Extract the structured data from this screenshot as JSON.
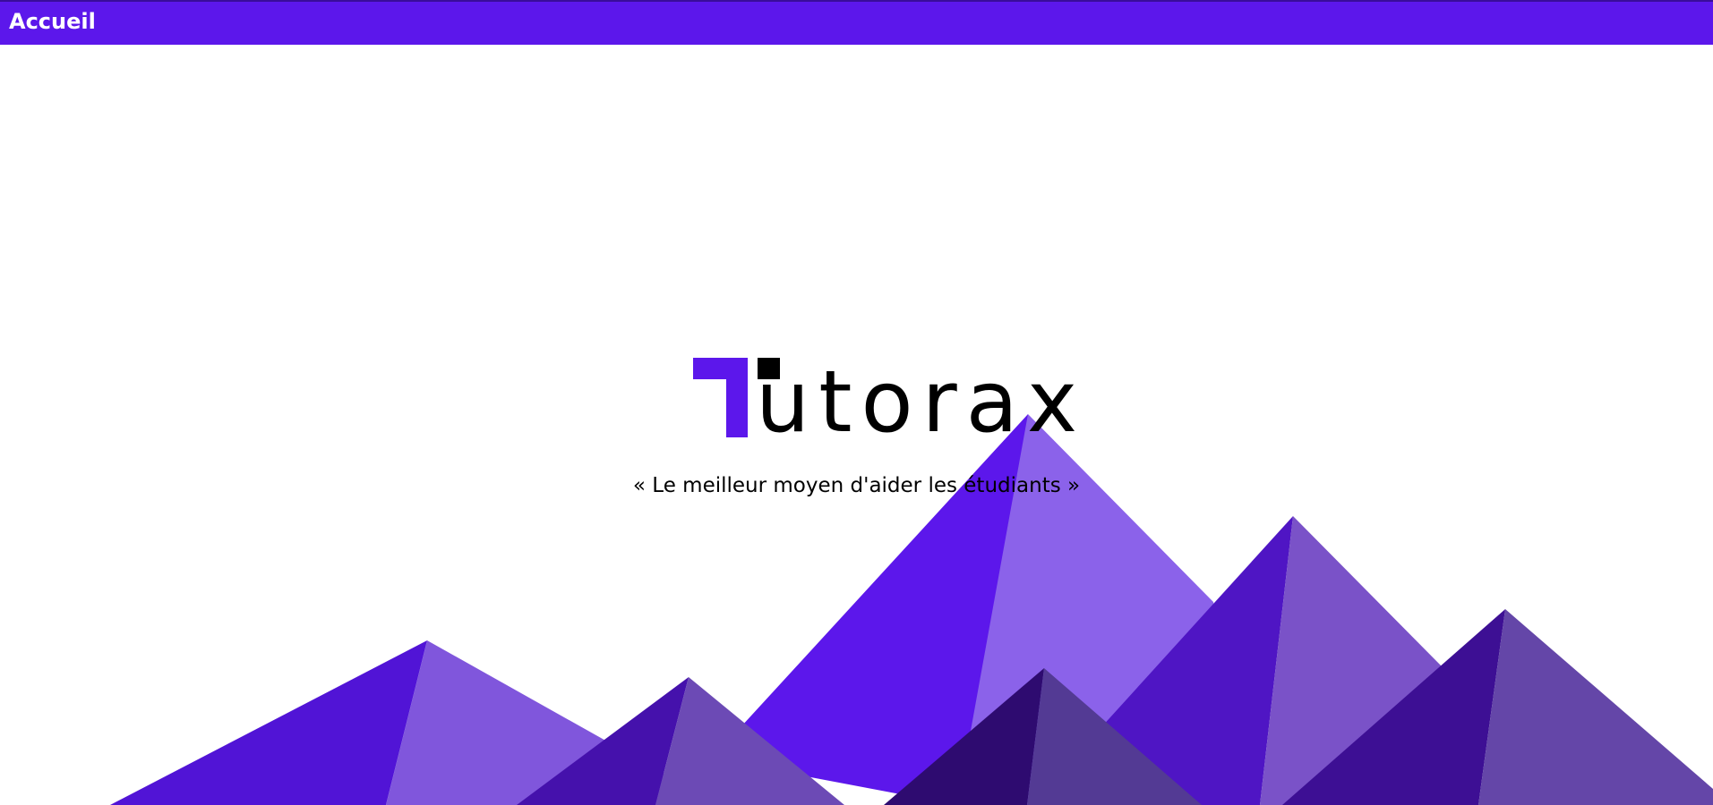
{
  "nav": {
    "home_label": "Accueil",
    "bar_color": "#5c17eb"
  },
  "hero": {
    "logo_text": "utorax",
    "logo_full": "Tutorax",
    "tagline": "« Le meilleur moyen d'aider les étudiants »",
    "brand_color": "#5c17eb"
  },
  "background": {
    "icon": "mountains-illustration",
    "colors": [
      "#5c17eb",
      "#8b62ea",
      "#4f15c4",
      "#7a52c8",
      "#3d0f94",
      "#6446a8",
      "#2e0b70",
      "#533a94"
    ]
  }
}
